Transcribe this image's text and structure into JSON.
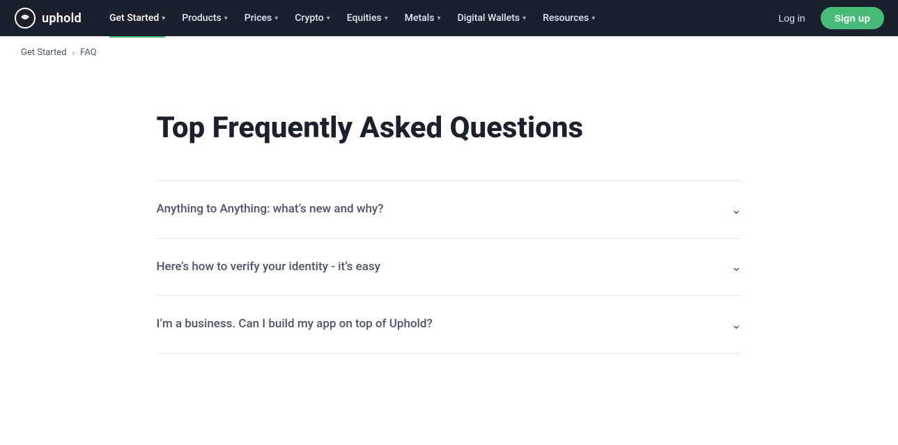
{
  "brand": {
    "name": "uphold",
    "logo_alt": "uphold logo"
  },
  "nav": {
    "items": [
      {
        "label": "Get Started",
        "active": true,
        "has_dropdown": true
      },
      {
        "label": "Products",
        "active": false,
        "has_dropdown": true
      },
      {
        "label": "Prices",
        "active": false,
        "has_dropdown": true
      },
      {
        "label": "Crypto",
        "active": false,
        "has_dropdown": true
      },
      {
        "label": "Equities",
        "active": false,
        "has_dropdown": true
      },
      {
        "label": "Metals",
        "active": false,
        "has_dropdown": true
      },
      {
        "label": "Digital Wallets",
        "active": false,
        "has_dropdown": true
      },
      {
        "label": "Resources",
        "active": false,
        "has_dropdown": true
      }
    ],
    "login_label": "Log in",
    "signup_label": "Sign up"
  },
  "breadcrumb": {
    "parent_label": "Get Started",
    "current_label": "FAQ",
    "separator": "›"
  },
  "page": {
    "title": "Top Frequently Asked Questions"
  },
  "faq": {
    "items": [
      {
        "question": "Anything to Anything: what’s new and why?"
      },
      {
        "question": "Here’s how to verify your identity - it’s easy"
      },
      {
        "question": "I’m a business. Can I build my app on top of Uphold?"
      }
    ]
  }
}
